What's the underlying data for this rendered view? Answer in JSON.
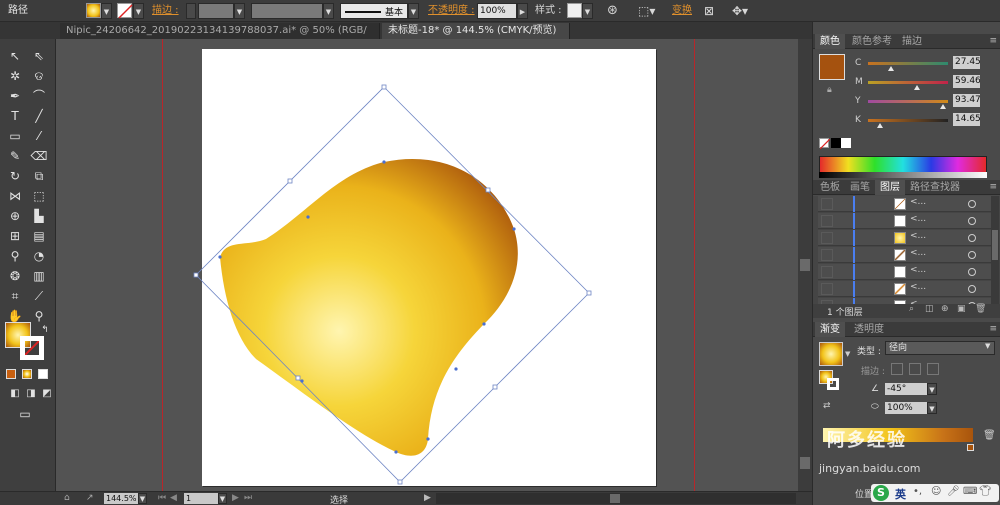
{
  "control_bar": {
    "object_type": "路径",
    "stroke_label": "描边 :",
    "stroke_style": "基本",
    "opacity_label": "不透明度 :",
    "opacity_value": "100%",
    "style_label": "样式 :",
    "transform_label": "变换"
  },
  "tabs": [
    {
      "label": "Nipic_24206642_20190223134139788037.ai* @ 50% (RGB/预览)",
      "active": false
    },
    {
      "label": "未标题-18* @ 144.5% (CMYK/预览)",
      "active": true
    }
  ],
  "status": {
    "zoom": "144.5%",
    "page": "1",
    "tool": "选择"
  },
  "color_panel": {
    "tabs": [
      "颜色",
      "颜色参考",
      "描边"
    ],
    "sliders": [
      {
        "name": "C",
        "value": "27.45"
      },
      {
        "name": "M",
        "value": "59.46"
      },
      {
        "name": "Y",
        "value": "93.47"
      },
      {
        "name": "K",
        "value": "14.65"
      }
    ],
    "swatch_color": "#a5520f"
  },
  "layers_panel": {
    "tabs": [
      "色板",
      "画笔",
      "图层",
      "路径查找器"
    ],
    "row_names": [
      "<...",
      "<...",
      "<...",
      "<...",
      "<...",
      "<...",
      "<..."
    ],
    "count": "1 个图层"
  },
  "gradient_panel": {
    "tabs": [
      "渐变",
      "透明度"
    ],
    "type_label": "类型 :",
    "type_value": "径向",
    "stroke_label": "描边 :",
    "angle_value": "-45°",
    "ratio_value": "100%",
    "location_label": "位置"
  },
  "watermark": {
    "text": "阿多经验",
    "url": "jingyan.baidu.com"
  },
  "tray": {
    "ime": "英"
  },
  "colors": {
    "accent_orange": "#e0902c",
    "gradient_light": "#fff5b0",
    "gradient_mid": "#f2c31a",
    "gradient_dark": "#a8540c"
  }
}
